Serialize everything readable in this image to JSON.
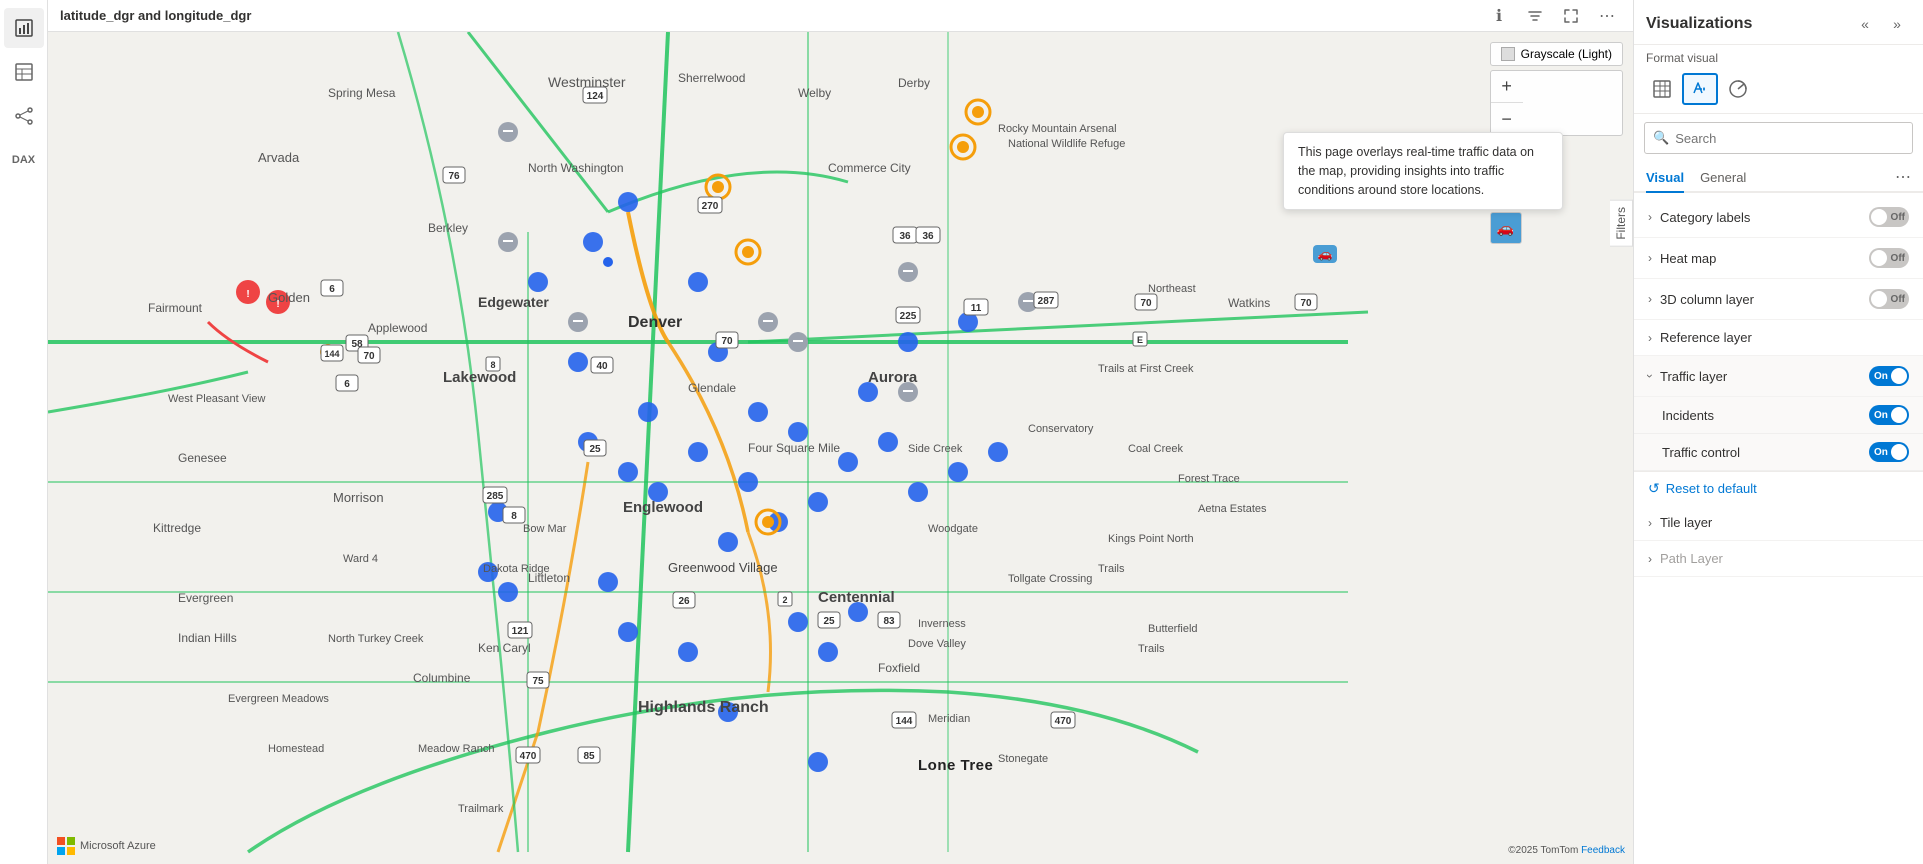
{
  "title": "latitude_dgr and longitude_dgr",
  "leftSidebar": {
    "icons": [
      {
        "name": "report-icon",
        "symbol": "📊",
        "active": true
      },
      {
        "name": "table-icon",
        "symbol": "⊞",
        "active": false
      },
      {
        "name": "model-icon",
        "symbol": "⬡",
        "active": false
      },
      {
        "name": "dax-icon",
        "symbol": "𝑓",
        "active": false
      }
    ]
  },
  "titleActions": [
    {
      "name": "info-icon",
      "symbol": "ℹ"
    },
    {
      "name": "filter-icon",
      "symbol": "⚗"
    },
    {
      "name": "expand-icon",
      "symbol": "⤢"
    },
    {
      "name": "more-icon",
      "symbol": "⋯"
    }
  ],
  "map": {
    "styleBadge": "Grayscale (Light)",
    "tooltip": "This page overlays real-time traffic data on the map, providing insights into traffic conditions around store locations.",
    "credit": "©2025 TomTom",
    "feedbackLink": "Feedback",
    "azureLabel": "Microsoft Azure",
    "placeLabel": "Lone Tree"
  },
  "rightPanel": {
    "title": "Visualizations",
    "collapseIcon": "«",
    "expandIcon": "»",
    "formatVisualLabel": "Format visual",
    "formatIcons": [
      {
        "name": "grid-format-icon",
        "symbol": "⊞",
        "active": false
      },
      {
        "name": "paint-format-icon",
        "symbol": "🖌",
        "active": true
      },
      {
        "name": "analytics-format-icon",
        "symbol": "📈",
        "active": false
      }
    ],
    "search": {
      "placeholder": "Search",
      "value": ""
    },
    "tabs": [
      {
        "label": "Visual",
        "active": true
      },
      {
        "label": "General",
        "active": false
      }
    ],
    "settingsItems": [
      {
        "label": "Category labels",
        "chevron": "›",
        "toggle": "off",
        "toggleLabel": "Off",
        "expanded": false
      },
      {
        "label": "Heat map",
        "chevron": "›",
        "toggle": "off",
        "toggleLabel": "Off",
        "expanded": false
      },
      {
        "label": "3D column layer",
        "chevron": "›",
        "toggle": "off",
        "toggleLabel": "Off",
        "expanded": false
      },
      {
        "label": "Reference layer",
        "chevron": "›",
        "toggle": null,
        "expanded": false
      },
      {
        "label": "Traffic layer",
        "chevron": "›",
        "toggle": "on",
        "toggleLabel": "On",
        "expanded": true
      },
      {
        "label": "Tile layer",
        "chevron": "›",
        "toggle": null,
        "expanded": false
      },
      {
        "label": "Path Layer",
        "chevron": "›",
        "toggle": null,
        "expanded": false,
        "dimmed": true
      }
    ],
    "trafficSubItems": [
      {
        "label": "Incidents",
        "toggle": "on",
        "toggleLabel": "On"
      },
      {
        "label": "Traffic control",
        "toggle": "on",
        "toggleLabel": "On"
      }
    ],
    "resetLabel": "Reset to default",
    "filtersLabel": "Filters"
  }
}
